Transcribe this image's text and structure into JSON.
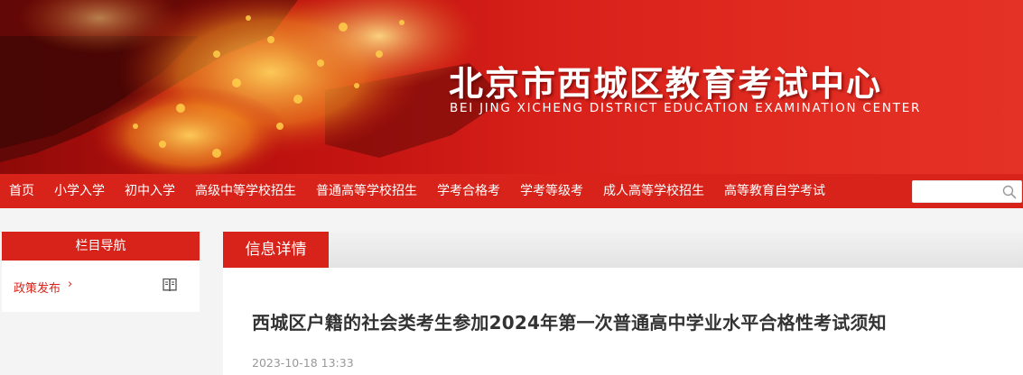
{
  "header": {
    "title": "北京市西城区教育考试中心",
    "subtitle": "BEI JING XICHENG DISTRICT EDUCATION EXAMINATION  CENTER"
  },
  "nav": {
    "items": [
      "首页",
      "小学入学",
      "初中入学",
      "高级中等学校招生",
      "普通高等学校招生",
      "学考合格考",
      "学考等级考",
      "成人高等学校招生",
      "高等教育自学考试"
    ],
    "search": {
      "value": "",
      "placeholder": "",
      "icon": "search-icon"
    }
  },
  "sidebar": {
    "title": "栏目导航",
    "items": [
      {
        "label": "政策发布",
        "chevron": "›",
        "icon": "book-icon"
      }
    ]
  },
  "main": {
    "section_tab": "信息详情",
    "article": {
      "title": "西城区户籍的社会类考生参加2024年第一次普通高中学业水平合格性考试须知",
      "date": "2023-10-18 13:33"
    }
  },
  "colors": {
    "brand_red": "#d7231a",
    "title_text": "#333333",
    "meta_text": "#999999"
  }
}
